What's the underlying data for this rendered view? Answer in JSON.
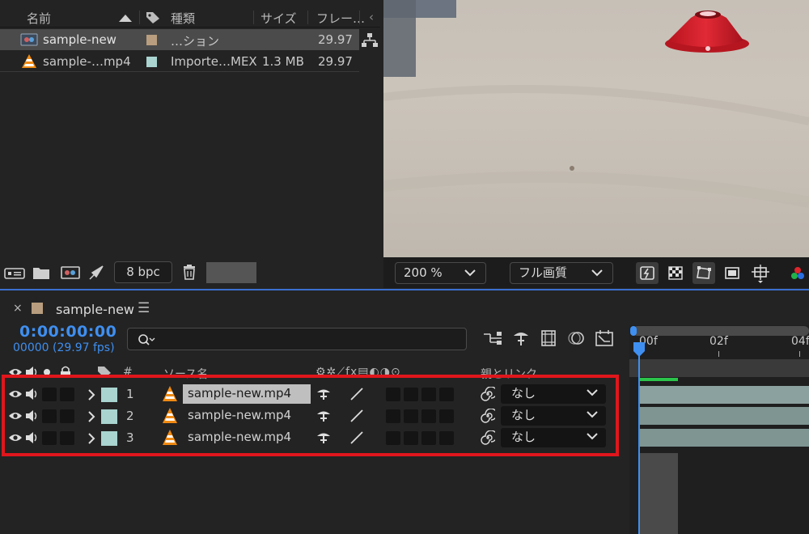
{
  "project": {
    "columns": {
      "name": "名前",
      "type": "種類",
      "size": "サイズ",
      "frame": "フレー…"
    },
    "items": [
      {
        "name": "sample-new",
        "type": "…ション",
        "size": "",
        "fps": "29.97",
        "swatch": "#b89e7e",
        "icon": "composition-icon",
        "selected": true
      },
      {
        "name": "sample-…mp4",
        "type": "Importe…MEX",
        "size": "1.3 MB",
        "fps": "29.97",
        "swatch": "#a9d4d0",
        "icon": "vlc-cone-icon",
        "selected": false
      }
    ],
    "bpc": "8 bpc"
  },
  "viewer": {
    "zoom": "200 %",
    "quality": "フル画質"
  },
  "timeline": {
    "tab_name": "sample-new",
    "timecode": "0:00:00:00",
    "frames": "00000 (29.97 fps)",
    "column_labels": {
      "num": "#",
      "source": "ソース名",
      "parent": "親とリンク"
    },
    "layers": [
      {
        "num": "1",
        "source": "sample-new.mp4",
        "parent": "なし",
        "selected": true
      },
      {
        "num": "2",
        "source": "sample-new.mp4",
        "parent": "なし",
        "selected": false
      },
      {
        "num": "3",
        "source": "sample-new.mp4",
        "parent": "なし",
        "selected": false
      }
    ],
    "ruler": {
      "marks": [
        "00f",
        "02f",
        "04f"
      ]
    }
  },
  "colors": {
    "accent_blue": "#3f8ff0",
    "highlight_red": "#e0161c",
    "layer_swatch": "#a9d4d0",
    "comp_swatch": "#b89e7e",
    "cone_red": "#d9202e"
  }
}
